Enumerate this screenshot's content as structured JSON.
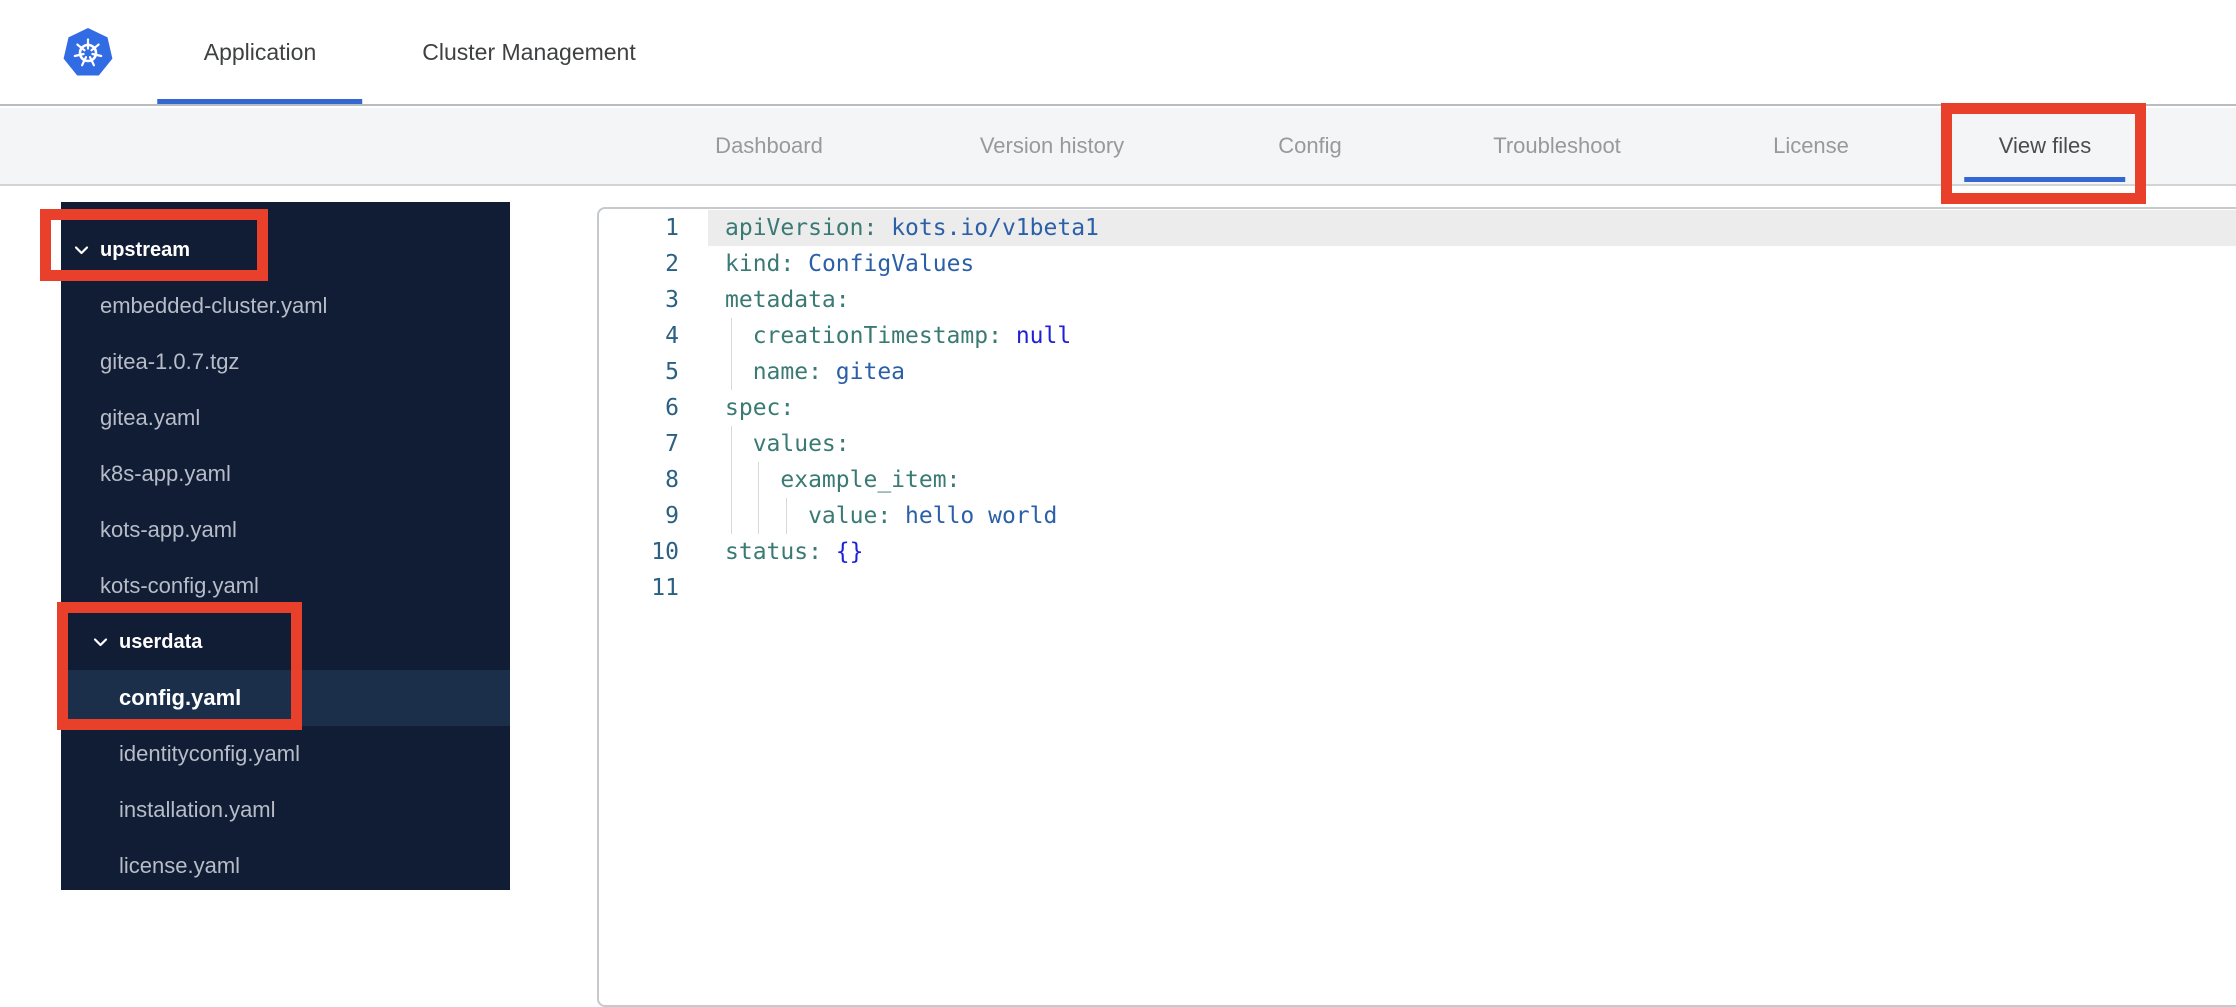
{
  "topnav": {
    "tabs": [
      {
        "label": "Application",
        "active": true
      },
      {
        "label": "Cluster Management",
        "active": false
      }
    ]
  },
  "subnav": {
    "tabs": [
      "Dashboard",
      "Version history",
      "Config",
      "Troubleshoot",
      "License",
      "View files"
    ],
    "active": "View files"
  },
  "sidebar": {
    "items": [
      {
        "type": "folder",
        "label": "upstream",
        "level": 1,
        "expanded": true,
        "selected": false
      },
      {
        "type": "file",
        "label": "embedded-cluster.yaml",
        "level": 1,
        "selected": false
      },
      {
        "type": "file",
        "label": "gitea-1.0.7.tgz",
        "level": 1,
        "selected": false
      },
      {
        "type": "file",
        "label": "gitea.yaml",
        "level": 1,
        "selected": false
      },
      {
        "type": "file",
        "label": "k8s-app.yaml",
        "level": 1,
        "selected": false
      },
      {
        "type": "file",
        "label": "kots-app.yaml",
        "level": 1,
        "selected": false
      },
      {
        "type": "file",
        "label": "kots-config.yaml",
        "level": 1,
        "selected": false
      },
      {
        "type": "folder",
        "label": "userdata",
        "level": 2,
        "expanded": true,
        "selected": false
      },
      {
        "type": "file",
        "label": "config.yaml",
        "level": 2,
        "selected": true
      },
      {
        "type": "file",
        "label": "identityconfig.yaml",
        "level": 2,
        "selected": false
      },
      {
        "type": "file",
        "label": "installation.yaml",
        "level": 2,
        "selected": false
      },
      {
        "type": "file",
        "label": "license.yaml",
        "level": 2,
        "selected": false
      }
    ]
  },
  "viewer": {
    "lines": [
      {
        "num": "1",
        "active": true,
        "guides": 0,
        "tokens": [
          {
            "c": "key",
            "t": "apiVersion:"
          },
          {
            "c": "plain",
            "t": " "
          },
          {
            "c": "val",
            "t": "kots.io/v1beta1"
          }
        ]
      },
      {
        "num": "2",
        "active": false,
        "guides": 0,
        "tokens": [
          {
            "c": "key",
            "t": "kind:"
          },
          {
            "c": "plain",
            "t": " "
          },
          {
            "c": "val",
            "t": "ConfigValues"
          }
        ]
      },
      {
        "num": "3",
        "active": false,
        "guides": 0,
        "tokens": [
          {
            "c": "key",
            "t": "metadata:"
          }
        ]
      },
      {
        "num": "4",
        "active": false,
        "guides": 1,
        "tokens": [
          {
            "c": "key",
            "t": "  creationTimestamp:"
          },
          {
            "c": "plain",
            "t": " "
          },
          {
            "c": "kw",
            "t": "null"
          }
        ]
      },
      {
        "num": "5",
        "active": false,
        "guides": 1,
        "tokens": [
          {
            "c": "key",
            "t": "  name:"
          },
          {
            "c": "plain",
            "t": " "
          },
          {
            "c": "val",
            "t": "gitea"
          }
        ]
      },
      {
        "num": "6",
        "active": false,
        "guides": 0,
        "tokens": [
          {
            "c": "key",
            "t": "spec:"
          }
        ]
      },
      {
        "num": "7",
        "active": false,
        "guides": 1,
        "tokens": [
          {
            "c": "key",
            "t": "  values:"
          }
        ]
      },
      {
        "num": "8",
        "active": false,
        "guides": 2,
        "tokens": [
          {
            "c": "key",
            "t": "    example_item:"
          }
        ]
      },
      {
        "num": "9",
        "active": false,
        "guides": 3,
        "tokens": [
          {
            "c": "key",
            "t": "      value:"
          },
          {
            "c": "plain",
            "t": " "
          },
          {
            "c": "val",
            "t": "hello world"
          }
        ]
      },
      {
        "num": "10",
        "active": false,
        "guides": 0,
        "tokens": [
          {
            "c": "key",
            "t": "status:"
          },
          {
            "c": "plain",
            "t": " "
          },
          {
            "c": "kw",
            "t": "{}"
          }
        ]
      },
      {
        "num": "11",
        "active": false,
        "guides": 0,
        "tokens": []
      }
    ]
  },
  "annotations": {
    "color": "#e8402a",
    "boxes": [
      "upstream-folder",
      "userdata-and-config-yaml",
      "view-files-tab"
    ]
  }
}
